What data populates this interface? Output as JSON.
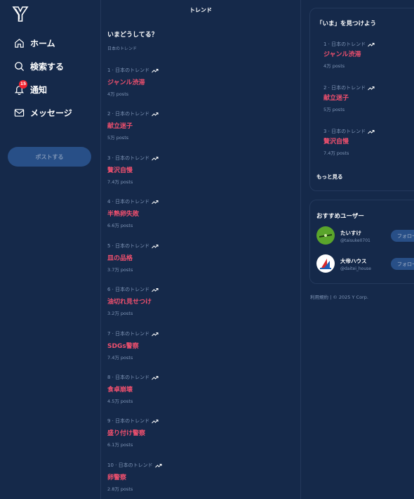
{
  "sidebar": {
    "nav": [
      {
        "label": "ホーム",
        "icon": "home-icon"
      },
      {
        "label": "検索する",
        "icon": "search-icon"
      },
      {
        "label": "通知",
        "icon": "bell-icon"
      },
      {
        "label": "メッセージ",
        "icon": "mail-icon"
      }
    ],
    "notification_count": "15",
    "post_label": "ポストする"
  },
  "main": {
    "header": "トレンド",
    "section_title": "いまどうしてる？",
    "section_sub": "日本のトレンド",
    "trends": [
      {
        "meta": "1 · 日本のトレンド",
        "name": "ジャンル渋滞",
        "posts": "4万 posts"
      },
      {
        "meta": "2 · 日本のトレンド",
        "name": "献立迷子",
        "posts": "5万 posts"
      },
      {
        "meta": "3 · 日本のトレンド",
        "name": "贅沢自慢",
        "posts": "7.4万 posts"
      },
      {
        "meta": "4 · 日本のトレンド",
        "name": "半熟卵失敗",
        "posts": "6.6万 posts"
      },
      {
        "meta": "5 · 日本のトレンド",
        "name": "皿の品格",
        "posts": "3.7万 posts"
      },
      {
        "meta": "6 · 日本のトレンド",
        "name": "油切れ見せつけ",
        "posts": "3.2万 posts"
      },
      {
        "meta": "7 · 日本のトレンド",
        "name": "SDGs警察",
        "posts": "7.4万 posts"
      },
      {
        "meta": "8 · 日本のトレンド",
        "name": "食卓崩壊",
        "posts": "4.5万 posts"
      },
      {
        "meta": "9 · 日本のトレンド",
        "name": "盛り付け警察",
        "posts": "6.1万 posts"
      },
      {
        "meta": "10 · 日本のトレンド",
        "name": "卵警察",
        "posts": "2.8万 posts"
      }
    ]
  },
  "right": {
    "trends_title": "「いま」を見つけよう",
    "trends": [
      {
        "meta": "1 · 日本のトレンド",
        "name": "ジャンル渋滞",
        "posts": "4万 posts"
      },
      {
        "meta": "2 · 日本のトレンド",
        "name": "献立迷子",
        "posts": "5万 posts"
      },
      {
        "meta": "3 · 日本のトレンド",
        "name": "贅沢自慢",
        "posts": "7.4万 posts"
      }
    ],
    "more_label": "もっと見る",
    "follow_title": "おすすめユーザー",
    "users": [
      {
        "name": "たいすけ",
        "handle": "@taisuke0701",
        "follow": "フォロー"
      },
      {
        "name": "大帝ハウス",
        "handle": "@daitei_house",
        "follow": "フォロー"
      }
    ],
    "footer": "利用規約 | © 2025 Y Corp."
  },
  "colors": {
    "background": "#15294a",
    "trend_name": "#f0506e",
    "muted": "#7f95b6",
    "button": "#284f87",
    "badge": "#f4212e"
  }
}
